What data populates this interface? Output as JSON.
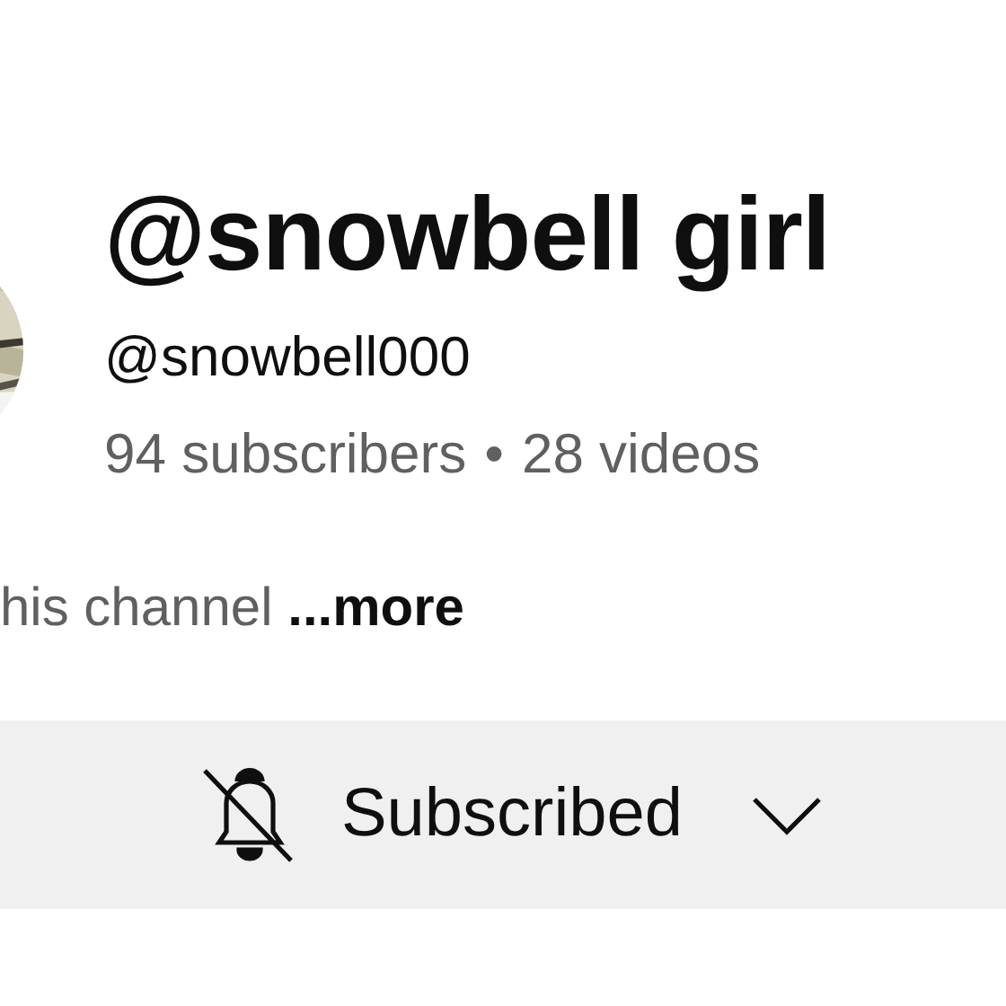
{
  "channel": {
    "name": "@snowbell girl",
    "handle": "@snowbell000",
    "subscribers": "94 subscribers",
    "separator": "•",
    "videos": "28 videos"
  },
  "description": {
    "text": "his channel",
    "more": "...more"
  },
  "subscribe_button": {
    "label": "Subscribed"
  }
}
